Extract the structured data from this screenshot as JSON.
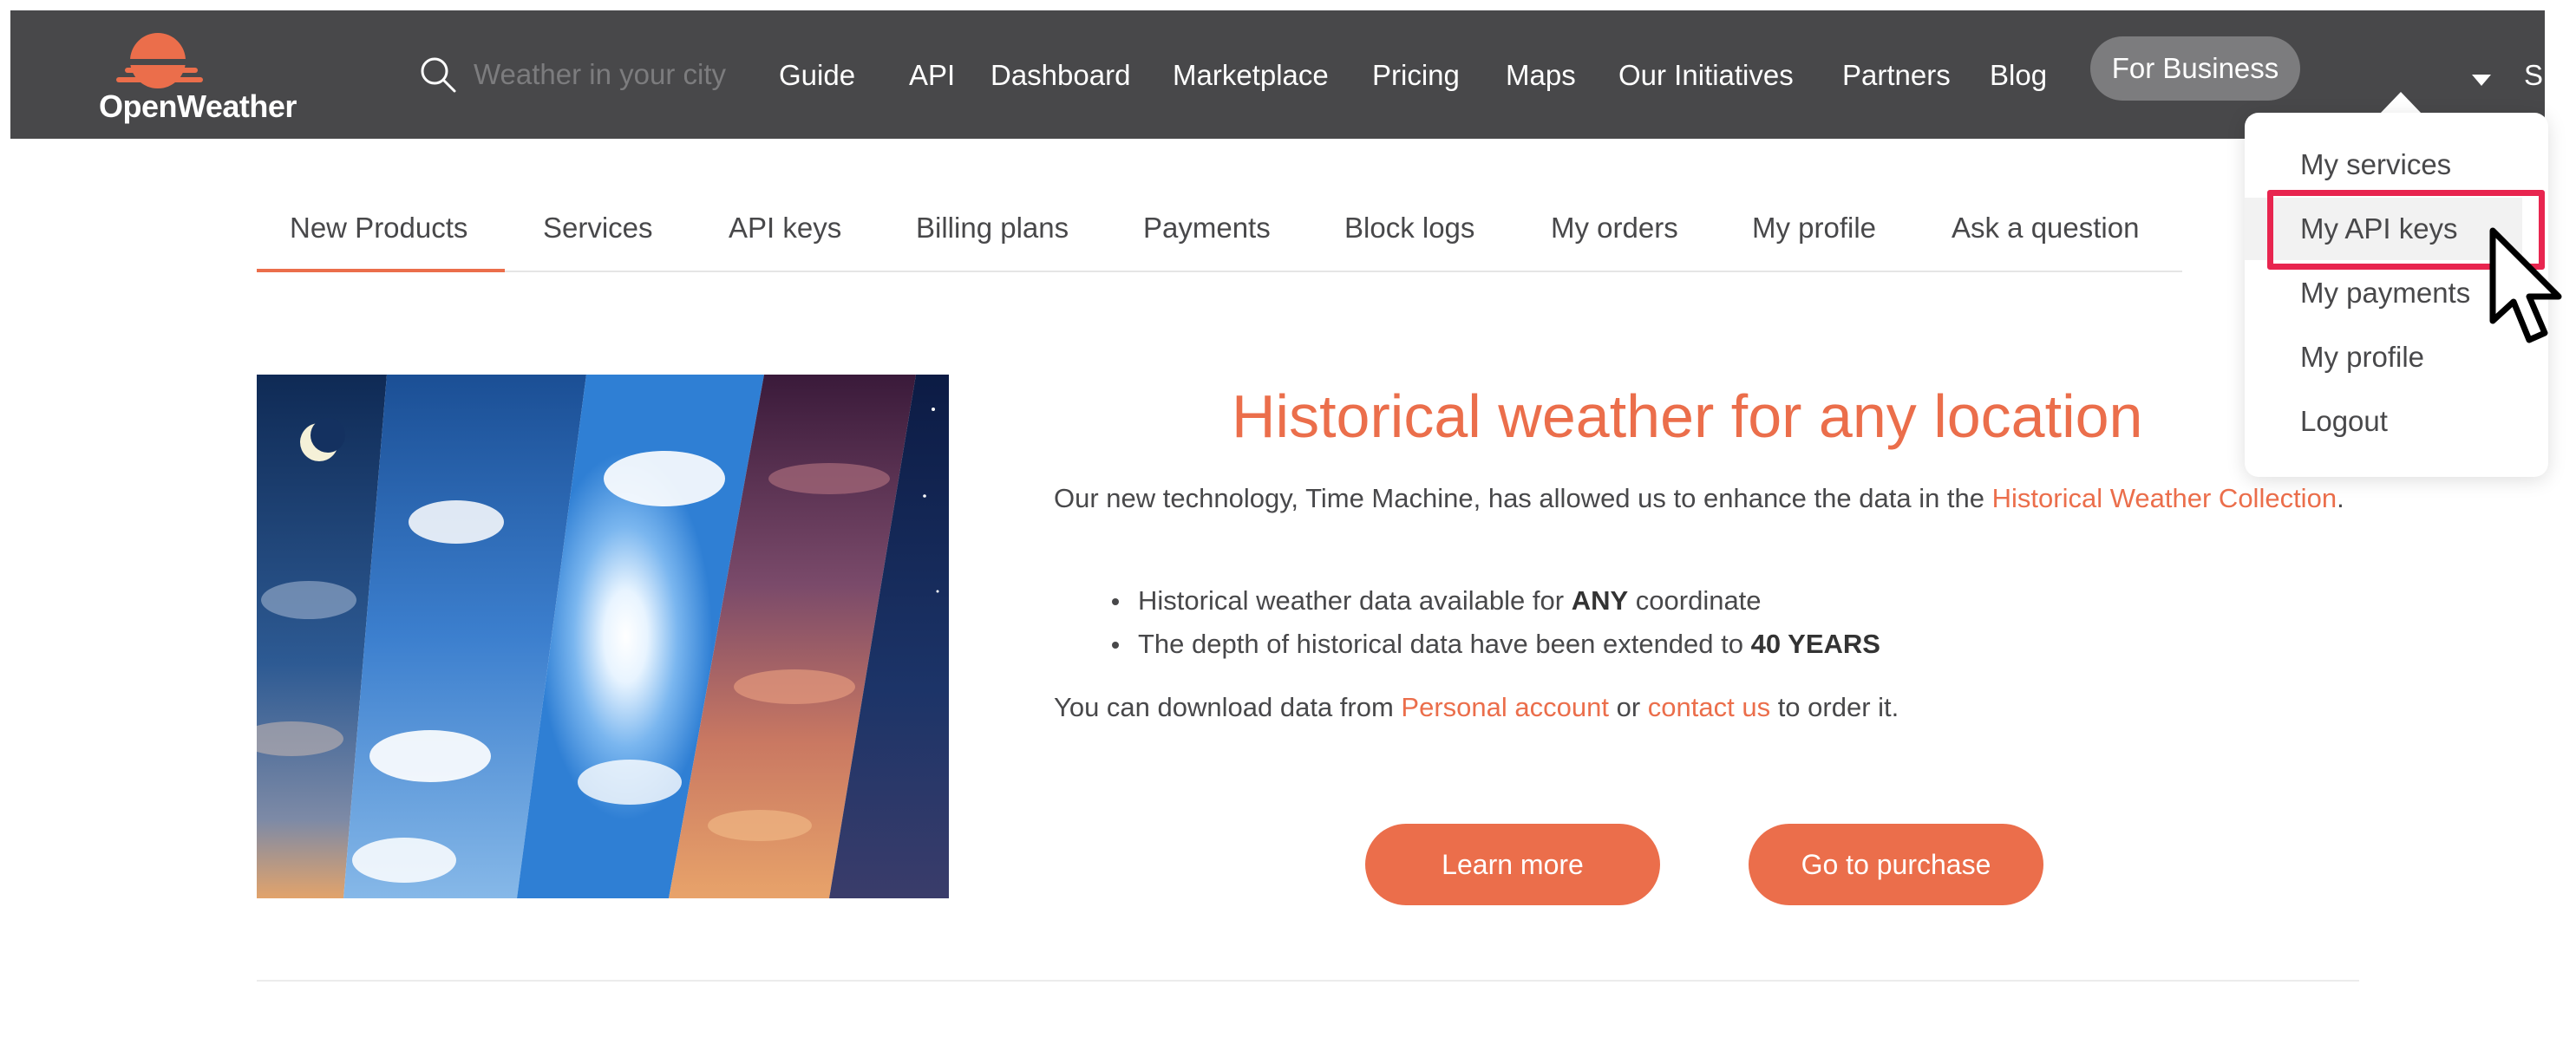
{
  "header": {
    "logo_text": "OpenWeather",
    "search_placeholder": "Weather in your city",
    "nav": [
      {
        "label": "Guide"
      },
      {
        "label": "API"
      },
      {
        "label": "Dashboard"
      },
      {
        "label": "Marketplace"
      },
      {
        "label": "Pricing"
      },
      {
        "label": "Maps"
      },
      {
        "label": "Our Initiatives"
      },
      {
        "label": "Partners"
      },
      {
        "label": "Blog"
      }
    ],
    "for_business_label": "For Business",
    "cut_label": "Su"
  },
  "tabs": [
    {
      "label": "New Products",
      "active": true
    },
    {
      "label": "Services"
    },
    {
      "label": "API keys"
    },
    {
      "label": "Billing plans"
    },
    {
      "label": "Payments"
    },
    {
      "label": "Block logs"
    },
    {
      "label": "My orders"
    },
    {
      "label": "My profile"
    },
    {
      "label": "Ask a question"
    }
  ],
  "main": {
    "headline": "Historical weather for any location",
    "intro_text": "Our new technology, Time Machine, has allowed us to enhance the data in the ",
    "intro_link": "Historical Weather Collection",
    "intro_end": ".",
    "bullets": [
      {
        "text": "Historical weather data available for ",
        "bold": "ANY",
        "after": " coordinate"
      },
      {
        "text": "The depth of historical data have been extended to ",
        "bold": "40 YEARS",
        "after": ""
      }
    ],
    "download_text_1": "You can download data from ",
    "download_link_1": "Personal account",
    "download_text_2": " or ",
    "download_link_2": "contact us",
    "download_text_3": " to order it.",
    "learn_more_label": "Learn more",
    "purchase_label": "Go to purchase"
  },
  "dropdown": {
    "items": [
      {
        "label": "My services"
      },
      {
        "label": "My API keys",
        "highlighted": true
      },
      {
        "label": "My payments"
      },
      {
        "label": "My profile"
      },
      {
        "label": "Logout"
      }
    ]
  },
  "colors": {
    "brand_orange": "#eb6e4b",
    "header_bg": "#48484a",
    "highlight_red": "#e8254f"
  }
}
